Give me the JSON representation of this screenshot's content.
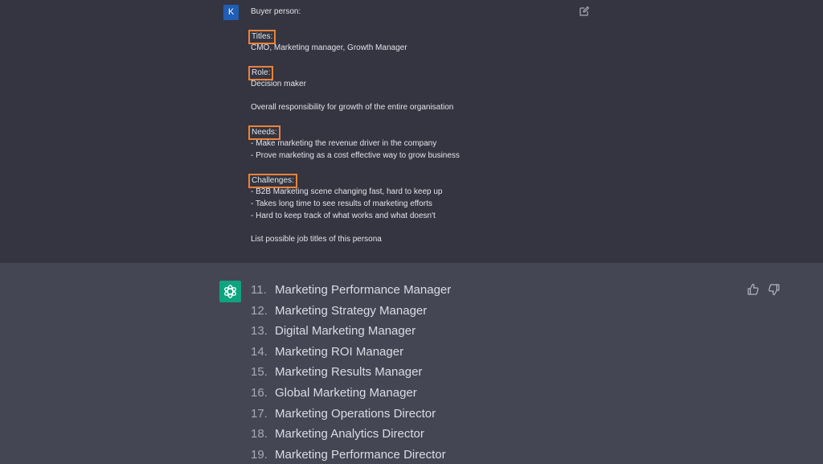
{
  "user": {
    "avatar_letter": "K",
    "prompt_lines": [
      {
        "text": "Buyer person:",
        "highlight": false
      },
      {
        "text": "Titles:",
        "highlight": true
      },
      {
        "text": "CMO, Marketing manager, Growth Manager",
        "highlight": false
      },
      {
        "text": "Role:",
        "highlight": true
      },
      {
        "text": "Decision maker",
        "highlight": false
      },
      {
        "text": "Overall responsibility for growth of the entire organisation",
        "highlight": false
      },
      {
        "text": "Needs:",
        "highlight": true
      },
      {
        "text": "- Make marketing the revenue driver in the company",
        "highlight": false
      },
      {
        "text": "- Prove marketing as a cost effective way to grow business",
        "highlight": false
      },
      {
        "text": "Challenges:",
        "highlight": true
      },
      {
        "text": "- B2B Marketing scene changing fast, hard to keep up",
        "highlight": false
      },
      {
        "text": "- Takes long time to see results of marketing efforts",
        "highlight": false
      },
      {
        "text": "- Hard to keep track of what works and what doesn't",
        "highlight": false
      },
      {
        "text": "List possible job titles of this persona",
        "highlight": false
      }
    ]
  },
  "assistant": {
    "items": [
      {
        "num": "11.",
        "title": "Marketing Performance Manager"
      },
      {
        "num": "12.",
        "title": "Marketing Strategy Manager"
      },
      {
        "num": "13.",
        "title": "Digital Marketing Manager"
      },
      {
        "num": "14.",
        "title": "Marketing ROI Manager"
      },
      {
        "num": "15.",
        "title": "Marketing Results Manager"
      },
      {
        "num": "16.",
        "title": "Global Marketing Manager"
      },
      {
        "num": "17.",
        "title": "Marketing Operations Director"
      },
      {
        "num": "18.",
        "title": "Marketing Analytics Director"
      },
      {
        "num": "19.",
        "title": "Marketing Performance Director"
      }
    ]
  },
  "icons": {
    "edit": "edit-icon",
    "thumbs_up": "thumbs-up-icon",
    "thumbs_down": "thumbs-down-icon",
    "assistant_logo": "openai-logo-icon"
  },
  "colors": {
    "highlight_border": "#e8833a",
    "user_avatar": "#1f5eb3",
    "assistant_avatar": "#10a37f"
  }
}
